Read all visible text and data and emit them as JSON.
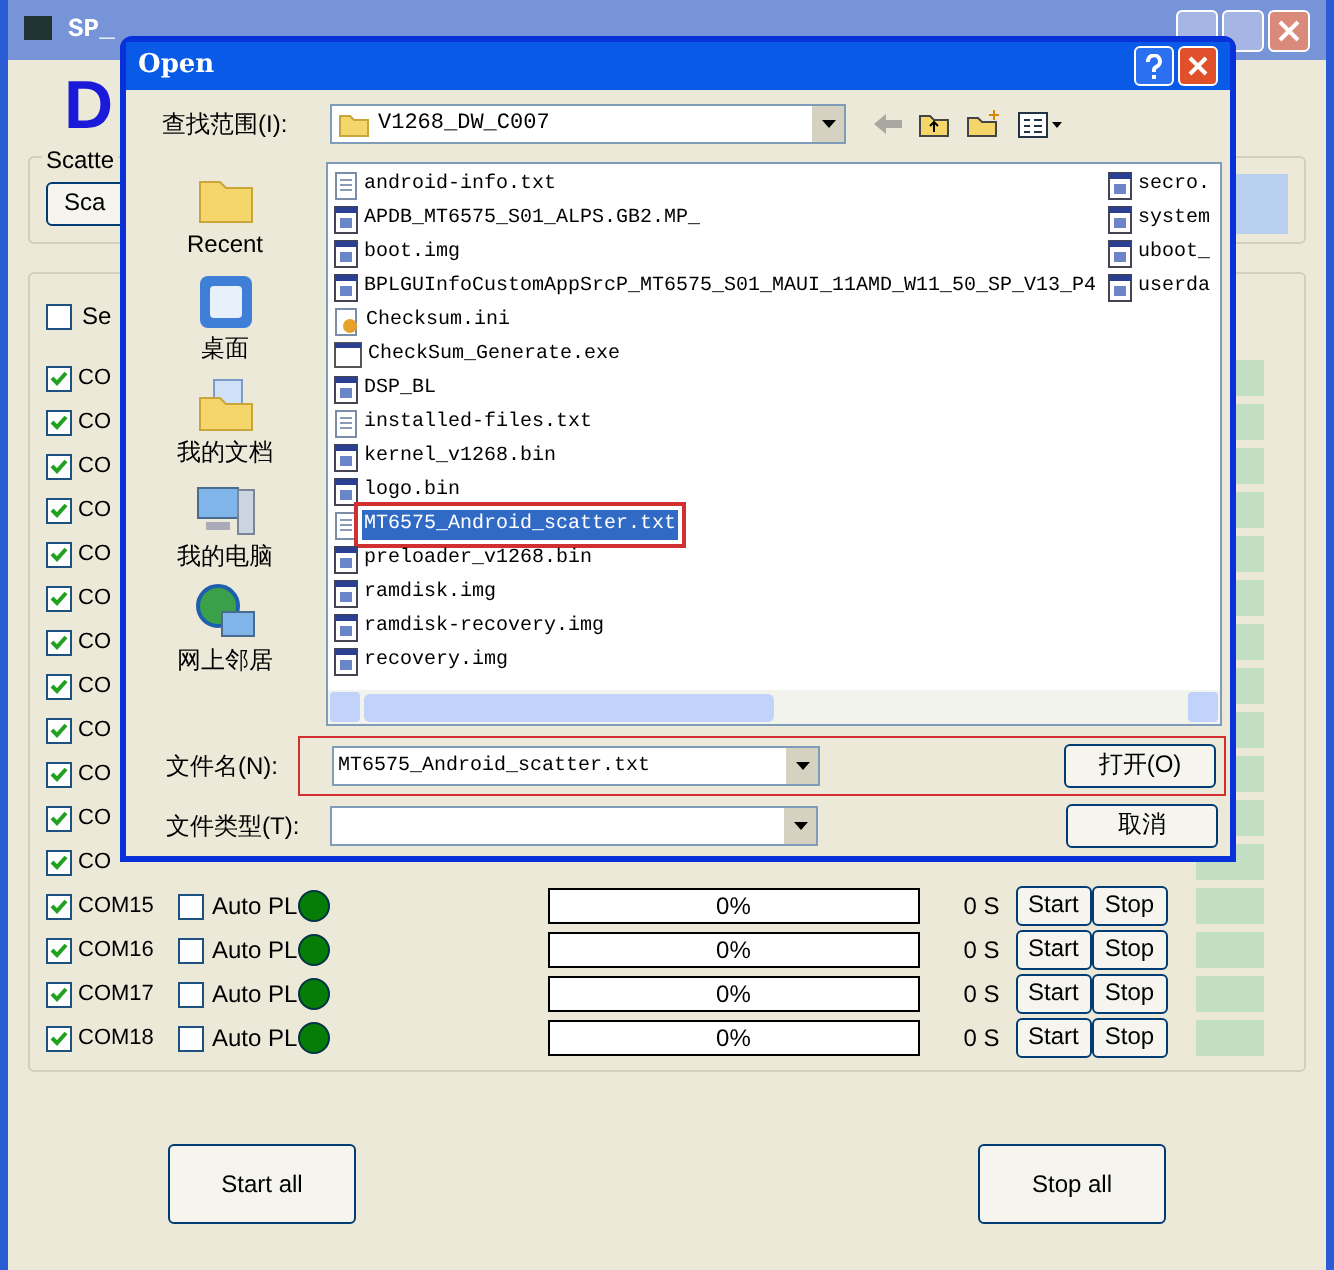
{
  "window": {
    "title": "SP_",
    "logo_letter": "D"
  },
  "scatter": {
    "legend": "Scatte",
    "button": "Sca"
  },
  "select_all": {
    "label": "Se",
    "checked": false
  },
  "ports": [
    {
      "kind": "covered",
      "label": "CO",
      "checked": true
    },
    {
      "kind": "covered",
      "label": "CO",
      "checked": true
    },
    {
      "kind": "covered",
      "label": "CO",
      "checked": true
    },
    {
      "kind": "covered",
      "label": "CO",
      "checked": true
    },
    {
      "kind": "covered",
      "label": "CO",
      "checked": true
    },
    {
      "kind": "covered",
      "label": "CO",
      "checked": true
    },
    {
      "kind": "covered",
      "label": "CO",
      "checked": true
    },
    {
      "kind": "covered",
      "label": "CO",
      "checked": true
    },
    {
      "kind": "covered",
      "label": "CO",
      "checked": true
    },
    {
      "kind": "covered",
      "label": "CO",
      "checked": true
    },
    {
      "kind": "covered",
      "label": "CO",
      "checked": true
    },
    {
      "kind": "covered",
      "label": "CO",
      "checked": true
    },
    {
      "kind": "full",
      "label": "COM15",
      "checked": true,
      "auto_label": "Auto PL",
      "auto_checked": false,
      "progress": "0%",
      "level": 0,
      "time": "0 S",
      "start": "Start",
      "stop": "Stop"
    },
    {
      "kind": "full",
      "label": "COM16",
      "checked": true,
      "auto_label": "Auto PL",
      "auto_checked": false,
      "progress": "0%",
      "level": 0,
      "time": "0 S",
      "start": "Start",
      "stop": "Stop"
    },
    {
      "kind": "full",
      "label": "COM17",
      "checked": true,
      "auto_label": "Auto PL",
      "auto_checked": false,
      "progress": "0%",
      "level": 0,
      "time": "0 S",
      "start": "Start",
      "stop": "Stop"
    },
    {
      "kind": "full",
      "label": "COM18",
      "checked": true,
      "auto_label": "Auto PL",
      "auto_checked": false,
      "progress": "0%",
      "level": 0,
      "time": "0 S",
      "start": "Start",
      "stop": "Stop"
    }
  ],
  "buttons": [
    "Start all",
    "Stop all"
  ],
  "dialog": {
    "title": "Open",
    "look_in": {
      "label": "查找范围(I):",
      "value": "V1268_DW_C007"
    },
    "places": [
      {
        "label": "Recent",
        "kind": "folder"
      },
      {
        "label": "桌面",
        "kind": "desktop"
      },
      {
        "label": "我的文档",
        "kind": "documents"
      },
      {
        "label": "我的电脑",
        "kind": "computer"
      },
      {
        "label": "网上邻居",
        "kind": "network"
      }
    ],
    "file_columns": [
      [
        {
          "name": "android-info.txt",
          "kind": "text",
          "selected": false
        },
        {
          "name": "APDB_MT6575_S01_ALPS.GB2.MP_",
          "kind": "binary",
          "selected": false
        },
        {
          "name": "boot.img",
          "kind": "binary",
          "selected": false
        },
        {
          "name": "BPLGUInfoCustomAppSrcP_MT6575_S01_MAUI_11AMD_W11_50_SP_V13_P4",
          "kind": "binary",
          "selected": false
        },
        {
          "name": "Checksum.ini",
          "kind": "ini",
          "selected": false
        },
        {
          "name": "CheckSum_Generate.exe",
          "kind": "exe",
          "selected": false
        },
        {
          "name": "DSP_BL",
          "kind": "binary",
          "selected": false
        },
        {
          "name": "installed-files.txt",
          "kind": "text",
          "selected": false
        },
        {
          "name": "kernel_v1268.bin",
          "kind": "binary",
          "selected": false
        },
        {
          "name": "logo.bin",
          "kind": "binary",
          "selected": false
        },
        {
          "name": "MT6575_Android_scatter.txt",
          "kind": "text",
          "selected": true
        },
        {
          "name": "preloader_v1268.bin",
          "kind": "binary",
          "selected": false
        },
        {
          "name": "ramdisk.img",
          "kind": "binary",
          "selected": false
        },
        {
          "name": "ramdisk-recovery.img",
          "kind": "binary",
          "selected": false
        },
        {
          "name": "recovery.img",
          "kind": "binary",
          "selected": false
        }
      ],
      [
        {
          "name": "secro.",
          "kind": "binary",
          "selected": false
        },
        {
          "name": "system",
          "kind": "binary",
          "selected": false
        },
        {
          "name": "uboot_",
          "kind": "binary",
          "selected": false
        },
        {
          "name": "userda",
          "kind": "binary",
          "selected": false
        }
      ]
    ],
    "file_name": {
      "label": "文件名(N):",
      "value": "MT6575_Android_scatter.txt",
      "highlighted": true
    },
    "file_type": {
      "label": "文件类型(T):"
    },
    "buttons": [
      "打开(O)",
      "取消"
    ]
  }
}
